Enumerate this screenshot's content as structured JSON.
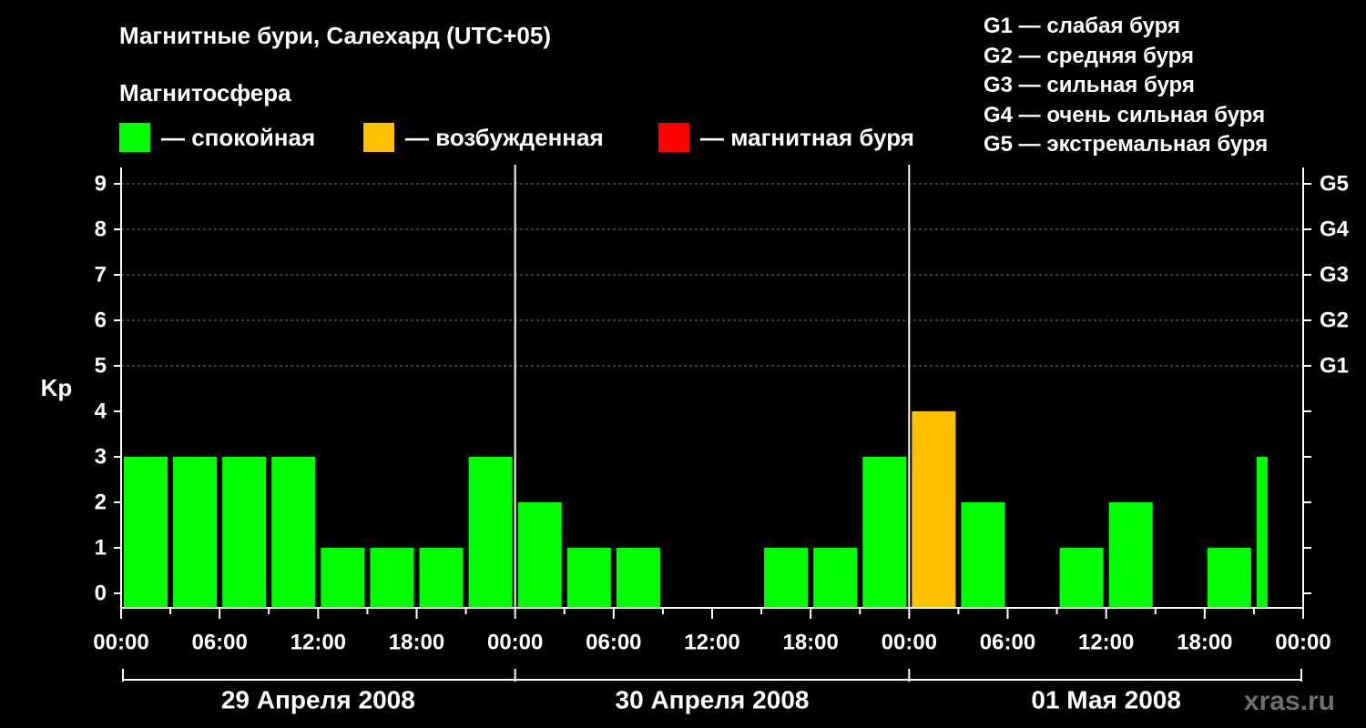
{
  "header": {
    "title": "Магнитные бури, Салехард (UTC+05)",
    "subtitle": "Магнитосфера"
  },
  "legend": [
    {
      "label": "— спокойная",
      "color": "#00ff00"
    },
    {
      "label": "— возбужденная",
      "color": "#ffc000"
    },
    {
      "label": "— магнитная буря",
      "color": "#ff0000"
    }
  ],
  "g_legend": [
    "G1 — слабая буря",
    "G2 — средняя буря",
    "G3 — сильная буря",
    "G4 — очень сильная буря",
    "G5 — экстремальная буря"
  ],
  "watermark": "xras.ru",
  "chart_data": {
    "type": "bar",
    "ylabel": "Kp",
    "ylim": [
      0,
      9
    ],
    "yticks": [
      "0",
      "1",
      "2",
      "3",
      "4",
      "5",
      "6",
      "7",
      "8",
      "9"
    ],
    "right_ticks": [
      {
        "kp": 5,
        "label": "G1"
      },
      {
        "kp": 6,
        "label": "G2"
      },
      {
        "kp": 7,
        "label": "G3"
      },
      {
        "kp": 8,
        "label": "G4"
      },
      {
        "kp": 9,
        "label": "G5"
      }
    ],
    "x_range_hours": [
      0,
      72
    ],
    "xtick_labels": [
      "00:00",
      "06:00",
      "12:00",
      "18:00",
      "00:00",
      "06:00",
      "12:00",
      "18:00",
      "00:00",
      "06:00",
      "12:00",
      "18:00",
      "00:00"
    ],
    "days": [
      "29 Апреля 2008",
      "30 Апреля 2008",
      "01 Мая 2008"
    ],
    "bar_start_hours": [
      0,
      3,
      6,
      9,
      12,
      15,
      18,
      21,
      24,
      27,
      30,
      33,
      36,
      39,
      42,
      45,
      48,
      51,
      54,
      57,
      60,
      63,
      66,
      69
    ],
    "values": [
      3,
      3,
      3,
      3,
      1,
      1,
      1,
      3,
      2,
      1,
      1,
      0,
      0,
      1,
      1,
      3,
      4,
      2,
      0,
      1,
      2,
      0,
      1,
      3
    ],
    "last_bar_partial_hours": 1,
    "colors": {
      "quiet": "#00ff00",
      "active": "#ffc000",
      "storm": "#ff0000",
      "grid": "#777777"
    }
  }
}
